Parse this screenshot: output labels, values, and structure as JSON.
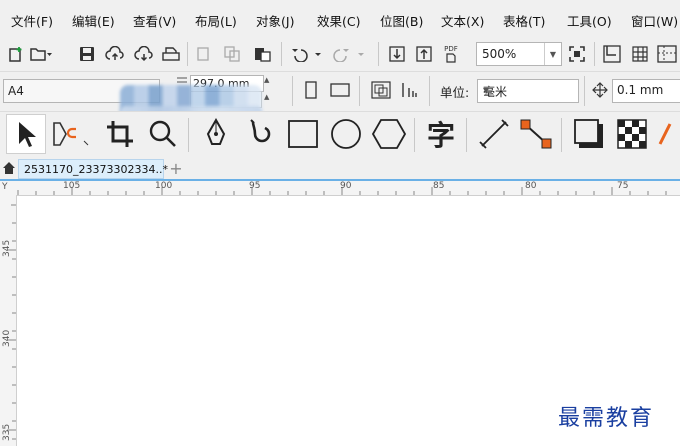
{
  "menubar": {
    "items": [
      "文件(F)",
      "编辑(E)",
      "查看(V)",
      "布局(L)",
      "对象(J)",
      "效果(C)",
      "位图(B)",
      "文本(X)",
      "表格(T)",
      "工具(O)",
      "窗口(W)"
    ]
  },
  "toolbar": {
    "zoom_value": "500%",
    "pdf_label": "PDF"
  },
  "property_bar": {
    "page_size": "A4",
    "width_value": "297.0 mm",
    "unit_label": "单位:",
    "unit_value": "毫米",
    "nudge_value": "0.1 mm"
  },
  "toolbox": {
    "text_tool_glyph": "字"
  },
  "tabs": {
    "home_icon": "home-icon",
    "document_title": "2531170_23373302334..*",
    "add_glyph": "+"
  },
  "ruler": {
    "h_labels": [
      "105",
      "100",
      "95",
      "90",
      "85",
      "80",
      "75"
    ],
    "v_labels": [
      "345",
      "340",
      "335"
    ],
    "corner_label": "Y"
  },
  "watermark": {
    "text": "最需教育"
  },
  "colors": {
    "menubar_bg": "#f0f0f0",
    "tab_active": "#dceefb",
    "tab_underline": "#6ab0e6",
    "accent_orange": "#e8641e",
    "watermark": "#1a3fa0"
  }
}
